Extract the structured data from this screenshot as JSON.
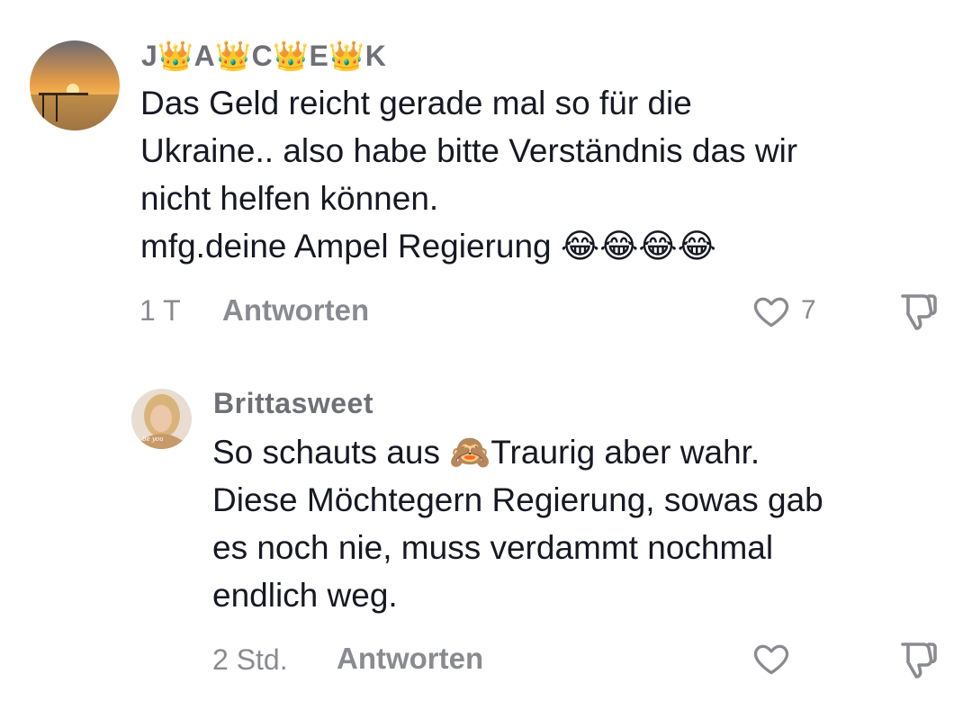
{
  "comments": [
    {
      "username": "J👑A👑C👑E👑K",
      "text_lines": [
        "Das Geld reicht gerade mal so für die",
        "Ukraine.. also habe bitte Verständnis das wir",
        "nicht helfen können.",
        "mfg.deine Ampel Regierung 😂😂😂😂"
      ],
      "time": "1 T",
      "reply_label": "Antworten",
      "like_count": "7"
    },
    {
      "username": "Brittasweet",
      "text_lines": [
        "So schauts aus 🙈Traurig aber wahr.",
        "Diese Möchtegern Regierung, sowas gab",
        "es noch nie, muss verdammt nochmal",
        "endlich weg."
      ],
      "time": "2 Std.",
      "reply_label": "Antworten",
      "like_count": ""
    }
  ],
  "icons": {
    "like": "heart-outline-icon",
    "dislike": "thumbs-down-icon",
    "username_decor": "crown-emoji"
  },
  "colors": {
    "text": "#161823",
    "secondary": "#8a8b91",
    "username": "#6f7077"
  }
}
